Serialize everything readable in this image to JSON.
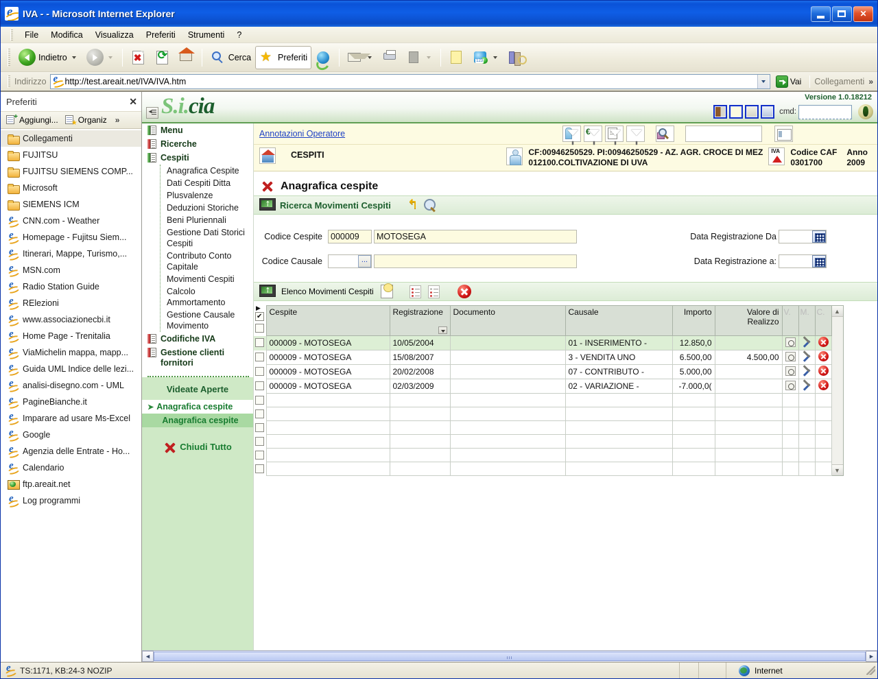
{
  "window": {
    "title": "IVA - - Microsoft Internet Explorer",
    "minimize_label": "",
    "maximize_label": "",
    "close_label": "✕"
  },
  "menubar": [
    "File",
    "Modifica",
    "Visualizza",
    "Preferiti",
    "Strumenti",
    "?"
  ],
  "toolbar": {
    "back_label": "Indietro",
    "search_label": "Cerca",
    "favorites_label": "Preferiti"
  },
  "addressbar": {
    "label": "Indirizzo",
    "url": "http://test.areait.net/IVA/IVA.htm",
    "go_label": "Vai",
    "links_label": "Collegamenti",
    "overflow_label": "»"
  },
  "favorites": {
    "title": "Preferiti",
    "close_label": "✕",
    "add_label": "Aggiungi...",
    "organize_label": "Organiz",
    "overflow_label": "»",
    "items": [
      {
        "label": "Collegamenti",
        "icon": "folder-icon",
        "selected": true
      },
      {
        "label": "FUJITSU",
        "icon": "folder-icon"
      },
      {
        "label": "FUJITSU SIEMENS COMP...",
        "icon": "folder-icon"
      },
      {
        "label": "Microsoft",
        "icon": "folder-icon"
      },
      {
        "label": "SIEMENS ICM",
        "icon": "folder-icon"
      },
      {
        "label": "CNN.com - Weather",
        "icon": "ie-page-icon"
      },
      {
        "label": "Homepage - Fujitsu Siem...",
        "icon": "ie-page-icon"
      },
      {
        "label": "Itinerari, Mappe, Turismo,...",
        "icon": "ie-page-icon"
      },
      {
        "label": "MSN.com",
        "icon": "ie-page-icon"
      },
      {
        "label": "Radio Station Guide",
        "icon": "ie-page-icon"
      },
      {
        "label": "RElezioni",
        "icon": "ie-page-icon"
      },
      {
        "label": "www.associazionecbi.it",
        "icon": "ie-page-icon"
      },
      {
        "label": "Home Page - Trenitalia",
        "icon": "ie-page-icon"
      },
      {
        "label": "ViaMichelin  mappa, mapp...",
        "icon": "ie-page-icon"
      },
      {
        "label": "Guida UML Indice delle lezi...",
        "icon": "ie-page-icon"
      },
      {
        "label": "analisi-disegno.com - UML",
        "icon": "ie-page-icon"
      },
      {
        "label": "PagineBianche.it",
        "icon": "ie-page-icon"
      },
      {
        "label": "Imparare ad usare Ms-Excel",
        "icon": "ie-page-icon"
      },
      {
        "label": "Google",
        "icon": "ie-page-icon"
      },
      {
        "label": "Agenzia delle Entrate - Ho...",
        "icon": "ie-page-icon"
      },
      {
        "label": "Calendario",
        "icon": "ie-page-icon"
      },
      {
        "label": "ftp.areait.net",
        "icon": "ftp-folder-icon"
      },
      {
        "label": "Log programmi",
        "icon": "ie-page-icon"
      }
    ]
  },
  "app": {
    "logo_part1": "S.i.",
    "logo_part2": "cia",
    "version": "Versione 1.0.18212",
    "cmd_label": "cmd:",
    "cmd_value": "",
    "nav": {
      "groups": [
        {
          "label": "Menu",
          "icon": "book-green-icon"
        },
        {
          "label": "Ricerche",
          "icon": "book-red-icon"
        },
        {
          "label": "Cespiti",
          "icon": "book-green-icon"
        }
      ],
      "cespiti_items": [
        "Anagrafica Cespite",
        "Dati Cespiti Ditta",
        "Plusvalenze",
        "Deduzioni Storiche",
        "Beni Pluriennali",
        "Gestione Dati Storici Cespiti",
        "Contributo Conto Capitale",
        "Movimenti Cespiti",
        "Calcolo Ammortamento",
        "Gestione Causale Movimento"
      ],
      "tail_groups": [
        {
          "label": "Codifiche IVA",
          "icon": "book-red-icon"
        },
        {
          "label": "Gestione clienti fornitori",
          "icon": "book-red-icon"
        }
      ]
    },
    "videate": {
      "title": "Videate Aperte",
      "items": [
        {
          "label": "Anagrafica cespite",
          "state": "white"
        },
        {
          "label": "Anagrafica cespite",
          "state": "green"
        }
      ],
      "close_all_label": "Chiudi Tutto"
    },
    "context": {
      "annotations_link": "Annotazioni Operatore",
      "module_title": "CESPITI",
      "customer_line1": "CF:00946250529. PI:00946250529 - AZ. AGR. CROCE DI MEZ",
      "customer_line2": "012100.COLTIVAZIONE DI UVA",
      "caf_label": "Codice CAF",
      "caf_value": "0301700",
      "year_label": "Anno",
      "year_value": "2009",
      "search_value": ""
    },
    "page": {
      "title": "Anagrafica cespite",
      "search_section_title": "Ricerca Movimenti Cespiti",
      "fields": {
        "codice_cespite_label": "Codice Cespite",
        "codice_cespite_value": "000009",
        "codice_cespite_desc": "MOTOSEGA",
        "codice_causale_label": "Codice Causale",
        "codice_causale_value": "",
        "codice_causale_desc": "",
        "dots_label": "...",
        "data_da_label": "Data Registrazione Da",
        "data_da_value": "",
        "data_a_label": "Data Registrazione a:",
        "data_a_value": ""
      },
      "grid_section_title": "Elenco Movimenti Cespiti",
      "grid": {
        "columns": [
          "Cespite",
          "Registrazione",
          "Documento",
          "Causale",
          "Importo",
          "Valore di Realizzo",
          "V.",
          "M.",
          "C."
        ],
        "rows": [
          {
            "cespite": "000009 - MOTOSEGA",
            "registrazione": "10/05/2004",
            "documento": "",
            "causale": "01 - INSERIMENTO -",
            "importo": "12.850,0",
            "valore": "",
            "selected": true
          },
          {
            "cespite": "000009 - MOTOSEGA",
            "registrazione": "15/08/2007",
            "documento": "",
            "causale": "3 - VENDITA UNO",
            "importo": "6.500,00",
            "valore": "4.500,00",
            "selected": false
          },
          {
            "cespite": "000009 - MOTOSEGA",
            "registrazione": "20/02/2008",
            "documento": "",
            "causale": "07 - CONTRIBUTO -",
            "importo": "5.000,00",
            "valore": "",
            "selected": false
          },
          {
            "cespite": "000009 - MOTOSEGA",
            "registrazione": "02/03/2009",
            "documento": "",
            "causale": "02 - VARIAZIONE -",
            "importo": "-7.000,0(",
            "valore": "",
            "selected": false
          }
        ],
        "empty_row_count": 6
      }
    }
  },
  "statusbar": {
    "text": "TS:1171, KB:24-3 NOZIP",
    "zone": "Internet"
  }
}
